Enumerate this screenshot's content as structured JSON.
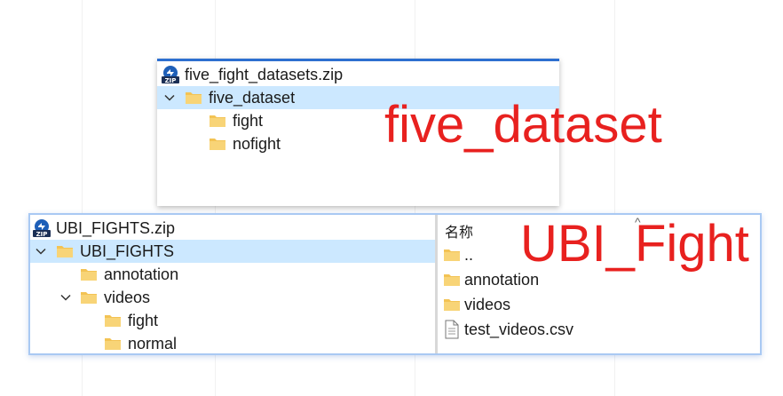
{
  "top_panel": {
    "archive_name": "five_fight_datasets.zip",
    "zip_badge": "ZIP",
    "tree": [
      {
        "label": "five_dataset",
        "expanded": true,
        "selected": true
      },
      {
        "label": "fight"
      },
      {
        "label": "nofight"
      }
    ]
  },
  "bottom_panel": {
    "archive_name": "UBI_FIGHTS.zip",
    "zip_badge": "ZIP",
    "tree": [
      {
        "label": "UBI_FIGHTS",
        "expanded": true,
        "selected": true
      },
      {
        "label": "annotation"
      },
      {
        "label": "videos",
        "expanded": true
      },
      {
        "label": "fight"
      },
      {
        "label": "normal"
      }
    ],
    "list": {
      "column_header": "名称",
      "items": [
        {
          "label": "..",
          "icon": "folder-icon"
        },
        {
          "label": "annotation",
          "icon": "folder-icon"
        },
        {
          "label": "videos",
          "icon": "folder-icon"
        },
        {
          "label": "test_videos.csv",
          "icon": "file-icon"
        }
      ]
    }
  },
  "overlays": {
    "five_label": "five_dataset",
    "ubi_label": "UBI_Fight"
  },
  "colors": {
    "overlay_red": "#e8211f",
    "selection_blue": "#cce8ff",
    "folder_yellow": "#f8d477",
    "accent_blue": "#2d6fd0"
  }
}
